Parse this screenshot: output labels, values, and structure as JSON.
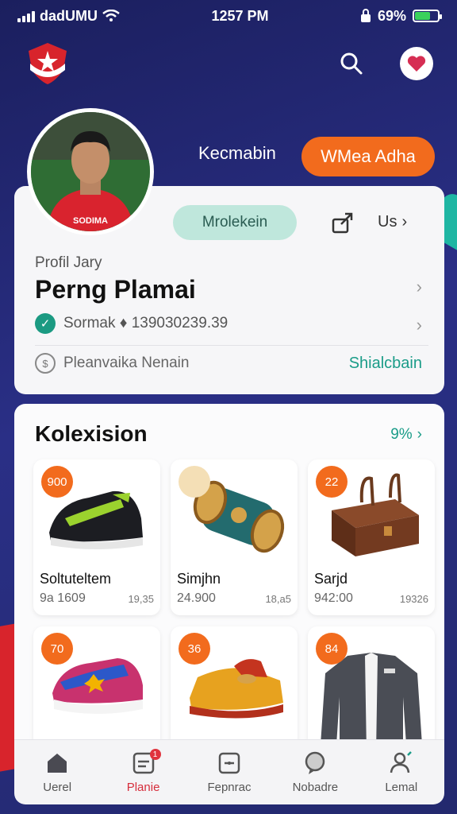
{
  "status_bar": {
    "carrier": "dadUMU",
    "time": "1257 PM",
    "battery_text": "69%",
    "battery_level": 0.69
  },
  "header": {
    "logo_icon": "eagle-shield-logo",
    "search_icon": "search-icon",
    "favorite_icon": "heart-icon"
  },
  "top_actions": {
    "link_label": "Kecmabin",
    "pill_label": "WMea Adha"
  },
  "profile": {
    "koleksi_label": "Mrolekein",
    "more_label": "Us",
    "label": "Profil Jary",
    "name": "Perng Plamai",
    "verify_text": "Sormak ♦ 1390302​39.39",
    "info_text": "Pleanvaika Nenain",
    "info_link": "Shialcbain"
  },
  "collection": {
    "title": "Kolexision",
    "more_label": "9%",
    "items": [
      {
        "badge": "900",
        "name": "Soltuteltem",
        "price": "9a 1609",
        "count": "19,35",
        "image": "sneaker-black-green"
      },
      {
        "badge": "",
        "name": "Simjhn",
        "price": "24.900",
        "count": "18,a5",
        "image": "treasure-barrel"
      },
      {
        "badge": "22",
        "name": "Sarjd",
        "price": "942:00",
        "count": "19326",
        "image": "wooden-chest"
      },
      {
        "badge": "70",
        "name": "",
        "price": "",
        "count": "",
        "image": "sneaker-pink-blue"
      },
      {
        "badge": "36",
        "name": "",
        "price": "",
        "count": "",
        "image": "golden-boot"
      },
      {
        "badge": "84",
        "name": "",
        "price": "",
        "count": "",
        "image": "grey-jacket"
      }
    ]
  },
  "nav": {
    "items": [
      {
        "label": "Uerel",
        "icon": "home-icon",
        "active": false
      },
      {
        "label": "Planie",
        "icon": "card-icon",
        "active": true,
        "badge": "1"
      },
      {
        "label": "Fepnrac",
        "icon": "panel-icon",
        "active": false
      },
      {
        "label": "Nobadre",
        "icon": "chat-icon",
        "active": false
      },
      {
        "label": "Lemal",
        "icon": "user-icon",
        "active": false
      }
    ]
  },
  "colors": {
    "accent": "#f26b1d",
    "teal": "#1a9c88",
    "background": "#23296e"
  }
}
